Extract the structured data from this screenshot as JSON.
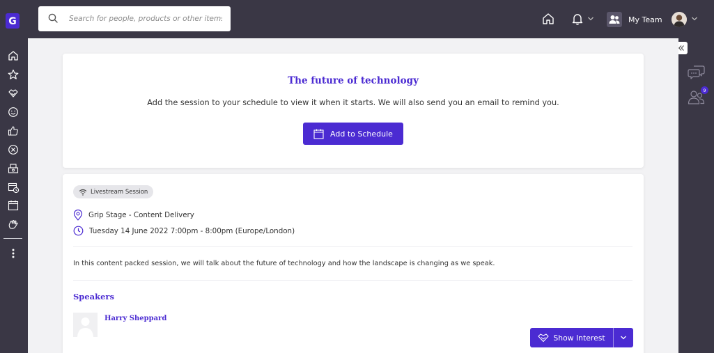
{
  "brand": {
    "logo_letter": "G",
    "accent": "#4b2bd2"
  },
  "search": {
    "placeholder": "Search for people, products or other items"
  },
  "header": {
    "team_label": "My Team"
  },
  "right_rail": {
    "notification_count": "9"
  },
  "session": {
    "title": "The future of technology",
    "description": "Add the session to your schedule to view it when it starts. We will also send you an email to remind you.",
    "add_button_label": "Add to Schedule",
    "type_badge": "Livestream Session",
    "location": "Grip Stage - Content Delivery",
    "datetime": "Tuesday 14 June 2022 7:00pm - 8:00pm (Europe/London)",
    "body": "In this content packed session, we will talk about the future of technology and how the landscape is changing as we speak.",
    "speakers_heading": "Speakers",
    "speakers": [
      {
        "name": "Harry Sheppard"
      }
    ]
  },
  "actions": {
    "show_interest_label": "Show Interest"
  },
  "icons": {
    "left_rail": [
      "home-icon",
      "star-icon",
      "handshake-icon",
      "smile-icon",
      "thumbs-up-icon",
      "circle-x-icon",
      "exhibitor-icon",
      "calendar-clock-icon",
      "calendar-icon",
      "hand-wave-icon",
      "more-vertical-icon"
    ],
    "right_rail": [
      "chat-icon",
      "people-icon"
    ]
  }
}
